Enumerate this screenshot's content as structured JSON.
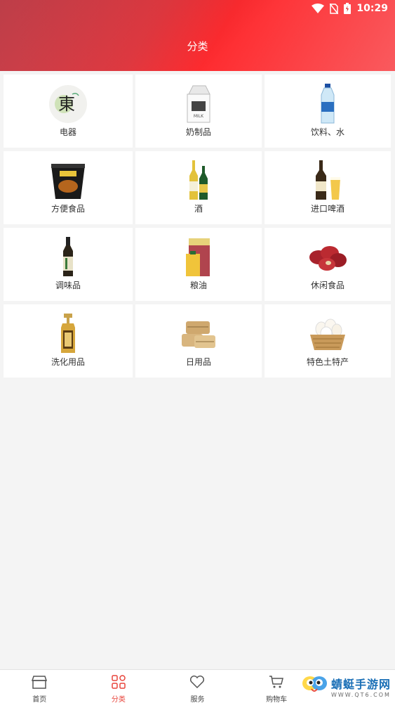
{
  "status_bar": {
    "time": "10:29"
  },
  "header": {
    "title": "分类"
  },
  "categories": [
    {
      "label": "电器",
      "icon": "dong-logo-icon"
    },
    {
      "label": "奶制品",
      "icon": "milk-carton-icon"
    },
    {
      "label": "饮料、水",
      "icon": "water-bottle-icon"
    },
    {
      "label": "方便食品",
      "icon": "instant-noodle-cup-icon"
    },
    {
      "label": "酒",
      "icon": "beer-bottles-icon"
    },
    {
      "label": "进口啤酒",
      "icon": "imported-beer-icon"
    },
    {
      "label": "调味品",
      "icon": "soy-sauce-bottle-icon"
    },
    {
      "label": "粮油",
      "icon": "rice-oil-icon"
    },
    {
      "label": "休闲食品",
      "icon": "red-dates-icon"
    },
    {
      "label": "洗化用品",
      "icon": "shampoo-bottle-icon"
    },
    {
      "label": "日用品",
      "icon": "towels-icon"
    },
    {
      "label": "特色土特产",
      "icon": "eggs-basket-icon"
    }
  ],
  "tabbar": {
    "items": [
      {
        "label": "首页",
        "icon": "home-store-icon",
        "active": false
      },
      {
        "label": "分类",
        "icon": "category-grid-icon",
        "active": true
      },
      {
        "label": "服务",
        "icon": "heart-icon",
        "active": false
      },
      {
        "label": "购物车",
        "icon": "cart-icon",
        "active": false
      }
    ]
  },
  "watermark": {
    "main": "蜻蜓手游网",
    "sub": "WWW.QT6.COM"
  },
  "colors": {
    "accent": "#e8453c",
    "header_red": "#ff2b2f",
    "background": "#f4f4f4"
  }
}
